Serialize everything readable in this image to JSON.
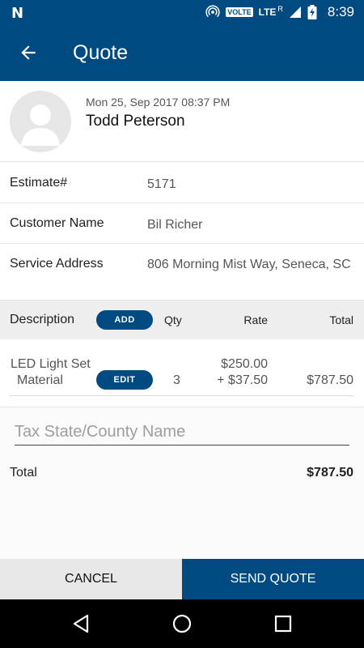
{
  "status_bar": {
    "network": "N",
    "volte": "VOLTE",
    "lte": "LTE",
    "roaming": "R",
    "time": "8:39"
  },
  "app_bar": {
    "title": "Quote",
    "back_icon": "arrow-back-icon"
  },
  "header": {
    "date": "Mon 25, Sep 2017 08:37 PM",
    "name": "Todd Peterson",
    "avatar_icon": "person-avatar-icon"
  },
  "fields": {
    "estimate": {
      "label": "Estimate#",
      "value": "5171"
    },
    "customer": {
      "label": "Customer Name",
      "value": "Bil Richer"
    },
    "address": {
      "label": "Service Address",
      "value": "806 Morning Mist Way, Seneca, SC"
    }
  },
  "items_header": {
    "description": "Description",
    "add_label": "ADD",
    "qty": "Qty",
    "rate": "Rate",
    "total": "Total"
  },
  "items": [
    {
      "name": "LED Light Set",
      "type": "Material",
      "edit_label": "EDIT",
      "qty": "3",
      "rate": "$250.00",
      "extra": "+ $37.50",
      "total": "$787.50"
    }
  ],
  "tax": {
    "placeholder": "Tax State/County Name",
    "value": ""
  },
  "summary": {
    "label": "Total",
    "value": "$787.50"
  },
  "actions": {
    "cancel": "CANCEL",
    "send": "SEND QUOTE"
  },
  "colors": {
    "primary": "#004a82",
    "header_bg": "#eeeeee",
    "cancel_bg": "#e8e8e8"
  }
}
